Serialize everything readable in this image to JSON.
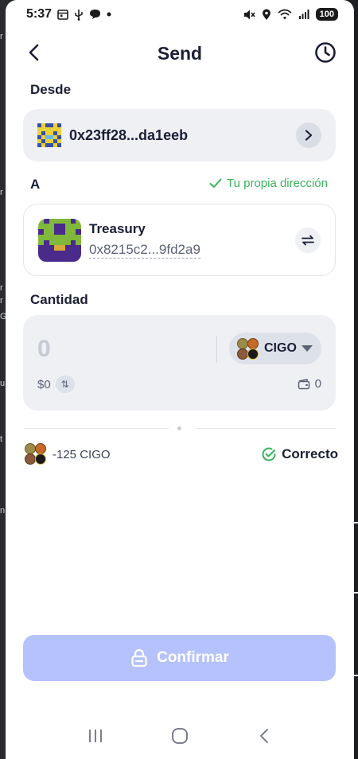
{
  "status_bar": {
    "time": "5:37",
    "left_icons": [
      "calendar-icon",
      "usb-icon",
      "chat-icon",
      "dot-icon"
    ],
    "right_icons": [
      "mute-icon",
      "location-icon",
      "wifi-icon",
      "signal-icon"
    ],
    "battery": "100"
  },
  "header": {
    "title": "Send",
    "back_icon": "chevron-left-icon",
    "history_icon": "clock-icon"
  },
  "from": {
    "label": "Desde",
    "address": "0x23ff28...da1eeb"
  },
  "to": {
    "label": "A",
    "own_address_note": "Tu propia dirección",
    "name": "Treasury",
    "address": "0x8215c2...9fd2a9"
  },
  "amount": {
    "label": "Cantidad",
    "placeholder": "0",
    "token_symbol": "CIGO",
    "usd_value": "$0",
    "usd_toggle": "⇅",
    "balance": "0"
  },
  "summary": {
    "amount_text": "-125 CIGO",
    "status": "Correcto"
  },
  "confirm": {
    "label": "Confirmar"
  },
  "colors": {
    "accent": "#b6c2fb",
    "success": "#3bb35c",
    "card_bg": "#eef0f4",
    "text_dark": "#1a1f36"
  }
}
